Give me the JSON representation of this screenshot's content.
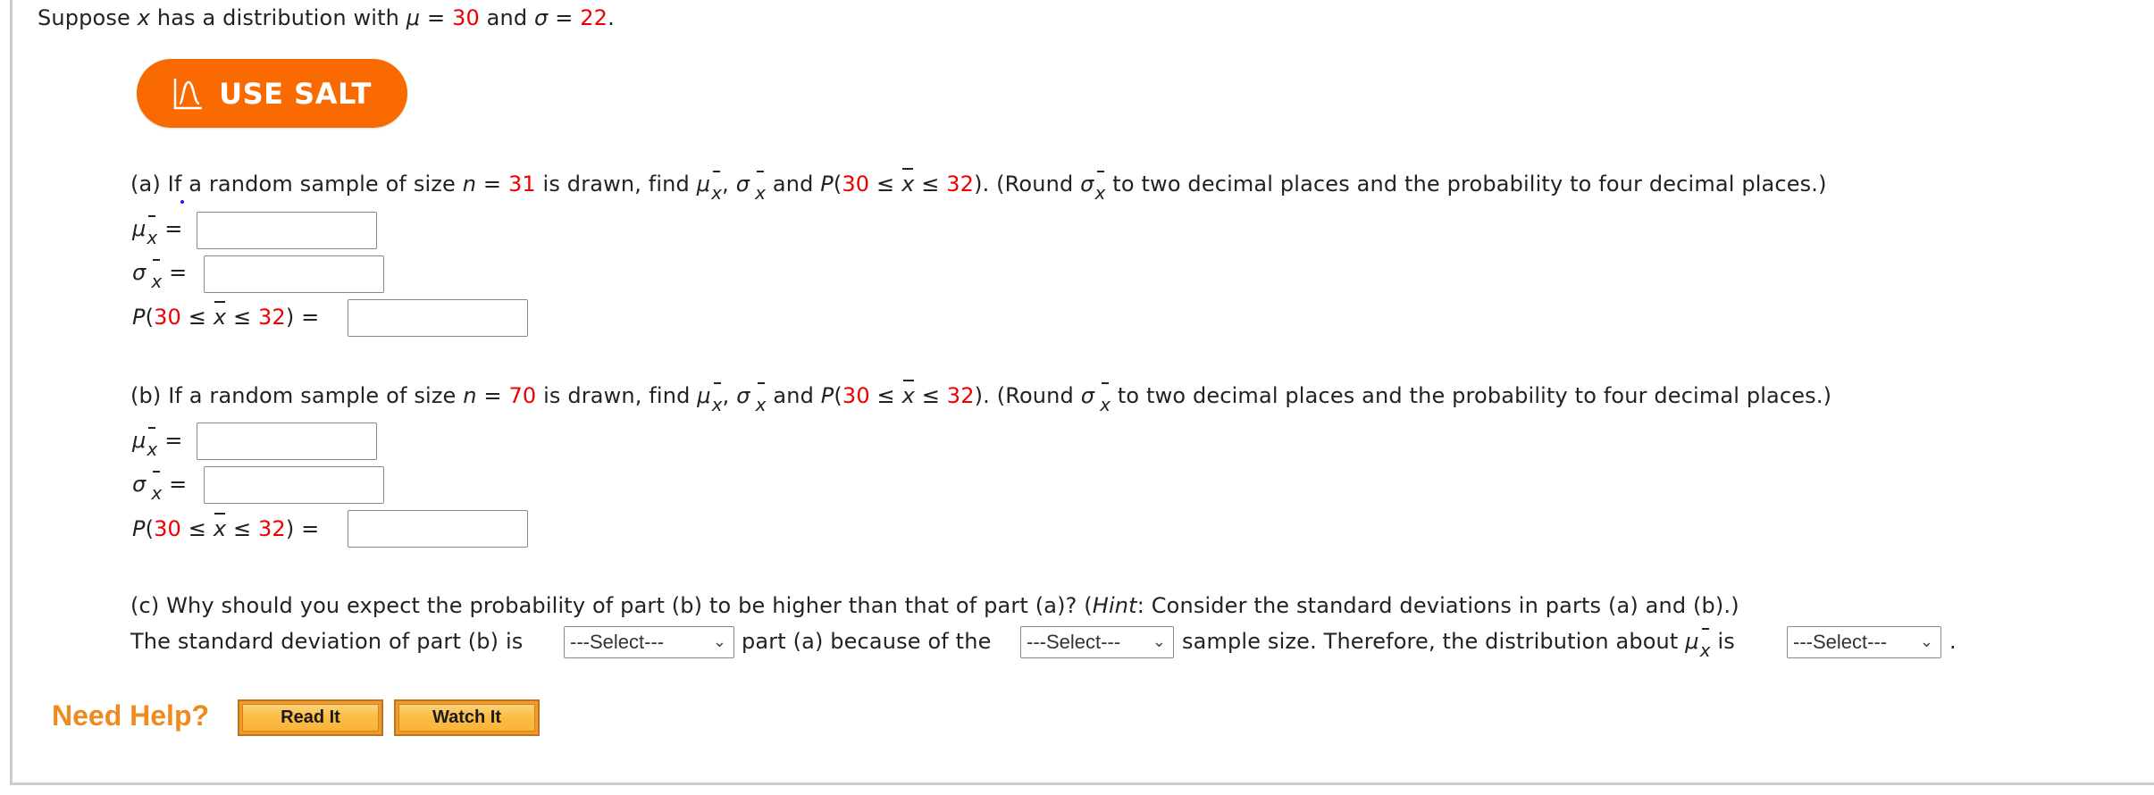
{
  "problem": {
    "intro_prefix": "Suppose ",
    "intro_var": "x",
    "intro_mid": " has a distribution with ",
    "mu_symbol": "μ",
    "sigma_symbol": "σ",
    "equals": " = ",
    "mu_value": "30",
    "and": " and ",
    "sigma_value": "22",
    "period": "."
  },
  "salt_button": {
    "label": "USE SALT",
    "icon": "bell-curve-chart-icon",
    "color": "#f96a00"
  },
  "symbols": {
    "x": "x",
    "n": "n",
    "P": "P",
    "le": "≤",
    "comma": ",",
    "open": "(",
    "close": ")"
  },
  "parts": [
    {
      "id": "a",
      "prefix": "(a) If a random sample of size ",
      "n_value": "31",
      "mid": " is drawn, find ",
      "and_word": " and ",
      "lower": "30",
      "upper": "32",
      "round_prefix": "). (Round ",
      "round_suffix": " to two decimal places and the probability to four decimal places.)",
      "fields": [
        {
          "label": "mu-xbar",
          "value": "",
          "placeholder": ""
        },
        {
          "label": "sigma-xbar",
          "value": "",
          "placeholder": ""
        },
        {
          "label": "probability",
          "value": "",
          "placeholder": ""
        }
      ]
    },
    {
      "id": "b",
      "prefix": "(b) If a random sample of size ",
      "n_value": "70",
      "mid": " is drawn, find ",
      "and_word": " and ",
      "lower": "30",
      "upper": "32",
      "round_prefix": "). (Round ",
      "round_suffix": " to two decimal places and the probability to four decimal places.)",
      "fields": [
        {
          "label": "mu-xbar",
          "value": "",
          "placeholder": ""
        },
        {
          "label": "sigma-xbar",
          "value": "",
          "placeholder": ""
        },
        {
          "label": "probability",
          "value": "",
          "placeholder": ""
        }
      ]
    }
  ],
  "part_c": {
    "question_prefix": "(c) Why should you expect the probability of part (b) to be higher than that of part (a)? (",
    "hint_word": "Hint",
    "question_suffix": ": Consider the standard deviations in parts (a) and (b).)",
    "line2_a": "The standard deviation of part (b) is ",
    "line2_b": " part (a) because of the ",
    "line2_c": " sample size. Therefore, the distribution about ",
    "line2_d": " is ",
    "line2_end": ".",
    "select_1": "---Select---",
    "select_2": "---Select---",
    "select_3": "---Select---"
  },
  "help": {
    "label": "Need Help?",
    "read_it": "Read It",
    "watch_it": "Watch It"
  },
  "colors": {
    "highlight_red": "#ee0000",
    "help_orange": "#ef8a1e",
    "button_orange": "#f59a1f"
  }
}
